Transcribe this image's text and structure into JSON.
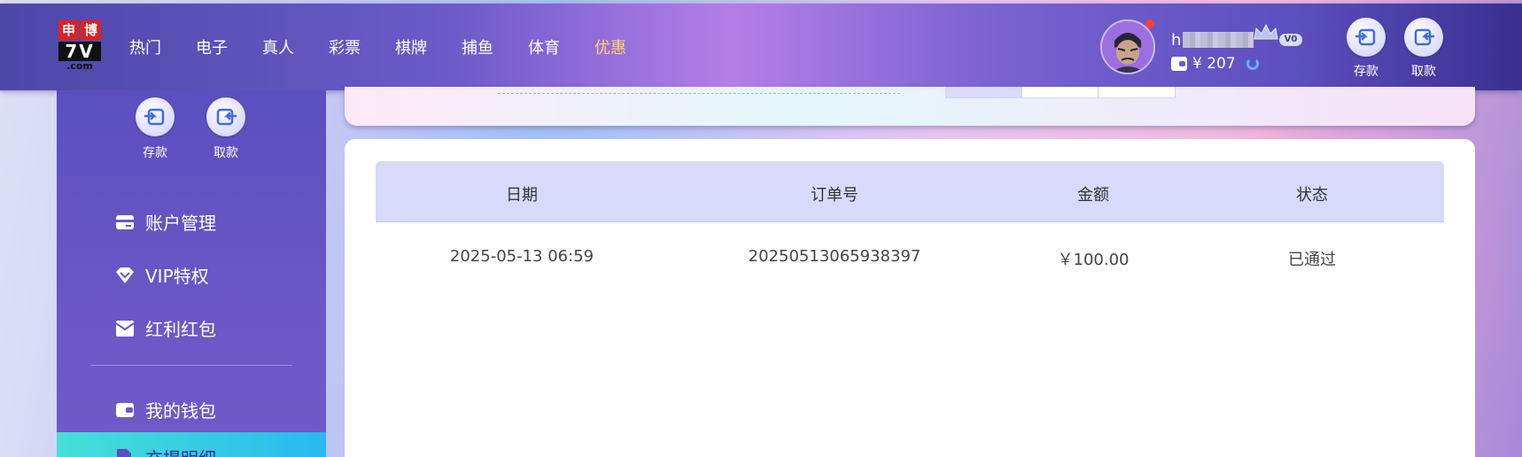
{
  "header": {
    "logo": {
      "top_left": "申",
      "top_right": "博",
      "middle": "7V",
      "bottom": ".com"
    },
    "nav": [
      {
        "label": "热门",
        "active": false
      },
      {
        "label": "电子",
        "active": false
      },
      {
        "label": "真人",
        "active": false
      },
      {
        "label": "彩票",
        "active": false
      },
      {
        "label": "棋牌",
        "active": false
      },
      {
        "label": "捕鱼",
        "active": false
      },
      {
        "label": "体育",
        "active": false
      },
      {
        "label": "优惠",
        "active": true
      }
    ],
    "username_initial": "h",
    "vip_level": "V0",
    "balance": "¥ 207",
    "deposit_label": "存款",
    "withdraw_label": "取款"
  },
  "sidebar": {
    "deposit_label": "存款",
    "withdraw_label": "取款",
    "items": [
      {
        "label": "账户管理",
        "icon": "card-icon"
      },
      {
        "label": "VIP特权",
        "icon": "diamond-icon"
      },
      {
        "label": "红利红包",
        "icon": "envelope-icon"
      },
      {
        "label": "我的钱包",
        "icon": "wallet-icon"
      },
      {
        "label": "充提明细",
        "icon": "document-icon",
        "active": true
      }
    ]
  },
  "table": {
    "columns": [
      "日期",
      "订单号",
      "金额",
      "状态"
    ],
    "rows": [
      {
        "date": "2025-05-13 06:59",
        "order_no": "20250513065938397",
        "amount": "￥100.00",
        "status": "已通过"
      }
    ]
  },
  "colors": {
    "accent_gold": "#ffd66b",
    "sidebar_bg": "#5b4fc0",
    "active_item": "#46e0d6",
    "table_header_bg": "#d8d9fb"
  }
}
